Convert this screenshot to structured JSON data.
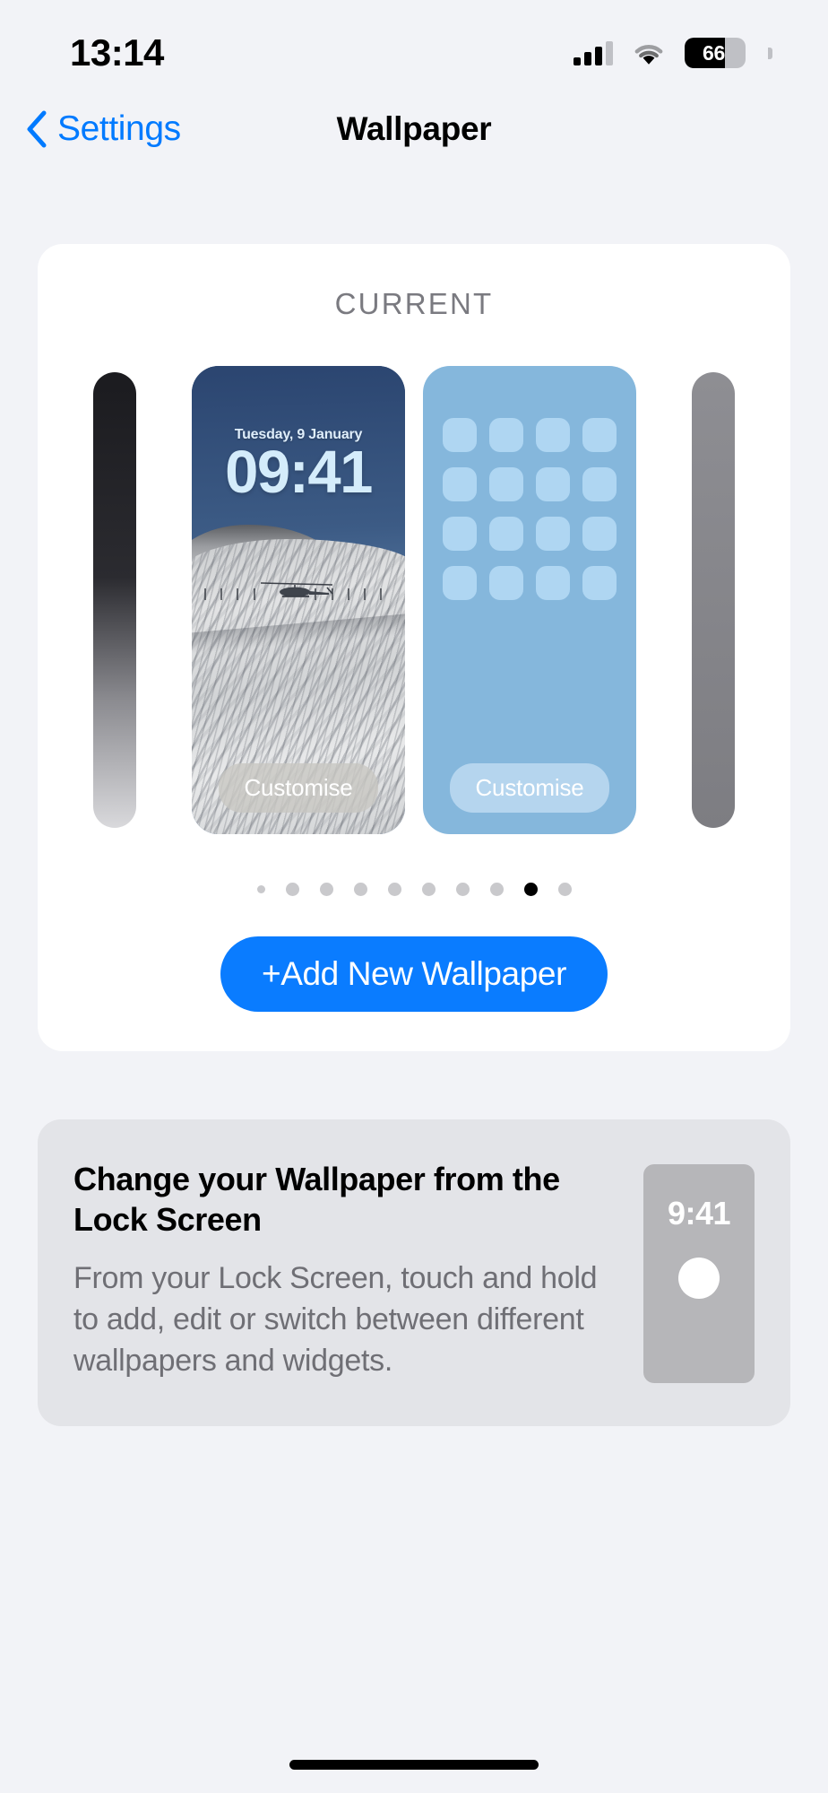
{
  "status_bar": {
    "time": "13:14",
    "battery_level": "66",
    "battery_percent": 66,
    "signal_bars_filled": 3,
    "signal_bars_total": 4,
    "wifi": "wifi-icon"
  },
  "nav": {
    "back_label": "Settings",
    "title": "Wallpaper"
  },
  "current_section": {
    "label": "CURRENT",
    "lock_screen": {
      "date": "Tuesday, 9 January",
      "time": "09:41",
      "customise_label": "Customise"
    },
    "home_screen": {
      "customise_label": "Customise",
      "icon_count": 16
    },
    "page_dots": {
      "total": 10,
      "active_index": 8
    },
    "add_button_label": "+Add New Wallpaper"
  },
  "info_card": {
    "title": "Change your Wallpaper from the Lock Screen",
    "body": "From your Lock Screen, touch and hold to add, edit or switch between different wallpapers and widgets.",
    "phone_time": "9:41"
  },
  "colors": {
    "accent_blue": "#0A7CFF",
    "link_blue": "#007AFF",
    "page_background": "#F2F3F7",
    "card_background": "#FFFFFF",
    "info_card_background": "#E3E4E8",
    "home_screen_blue": "#85B7DC",
    "home_icon_blue": "#AFD6F2"
  }
}
